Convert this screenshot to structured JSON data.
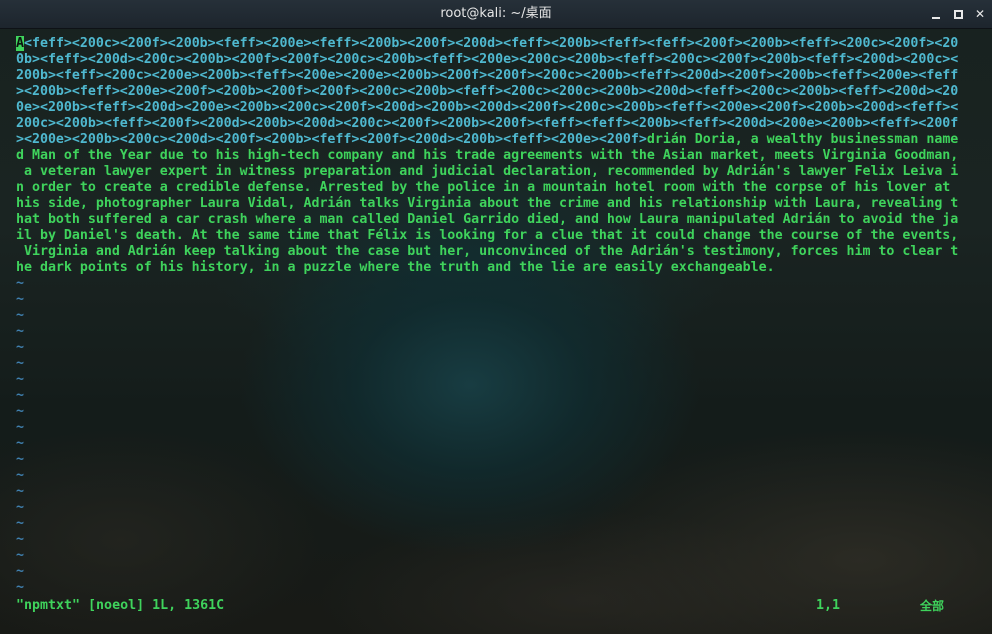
{
  "window": {
    "title": "root@kali: ~/桌面",
    "controls": [
      "minimize",
      "maximize",
      "close"
    ]
  },
  "editor": {
    "cursor_char": "A",
    "lines": [
      "<feff><200c><200f><200b><feff><200e><feff><200b><200f><200d><feff><200b><feff><feff><200f><200b><feff><200c><200f><20",
      "0b><feff><200d><200c><200b><200f><200f><200c><200b><feff><200e><200c><200b><feff><200c><200f><200b><feff><200d><200c><",
      "200b><feff><200c><200e><200b><feff><200e><200e><200b><200f><200f><200c><200b><feff><200d><200f><200b><feff><200e><feff",
      "><200b><feff><200e><200f><200b><200f><200f><200c><200b><feff><200c><200c><200b><200d><feff><200c><200b><feff><200d><20",
      "0e><200b><feff><200d><200e><200b><200c><200f><200d><200b><200d><200f><200c><200b><feff><200e><200f><200b><200d><feff><",
      "200c><200b><feff><200f><200d><200b><200d><200c><200f><200b><200f><feff><feff><200b><feff><200d><200e><200b><feff><200f",
      "><200e><200b><200c><200d><200f><200b><feff><200f><200d><200b><feff><200e><200f>drián Doria, a wealthy businessman name",
      "d Man of the Year due to his high-tech company and his trade agreements with the Asian market, meets Virginia Goodman,",
      " a veteran lawyer expert in witness preparation and judicial declaration, recommended by Adrián's lawyer Felix Leiva i",
      "n order to create a credible defense. Arrested by the police in a mountain hotel room with the corpse of his lover at",
      "his side, photographer Laura Vidal, Adrián talks Virginia about the crime and his relationship with Laura, revealing t",
      "hat both suffered a car crash where a man called Daniel Garrido died, and how Laura manipulated Adrián to avoid the ja",
      "il by Daniel's death. At the same time that Félix is looking for a clue that it could change the course of the events,",
      " Virginia and Adrián keep talking about the case but her, unconvinced of the Adrián's testimony, forces him to clear t",
      "he dark points of his history, in a puzzle where the truth and the lie are easily exchangeable."
    ],
    "line6_special": "><200e><200b><200c><200d><200f><200b><feff><200f><200d><200b><feff><200e><200f>",
    "line6_text": "drián Doria, a wealthy businessman name",
    "tilde": "~",
    "status": {
      "file_info": "\"npmtxt\" [noeol] 1L, 1361C",
      "position": "1,1",
      "scroll": "全部"
    }
  },
  "colors": {
    "text_green": "#3fd35c",
    "special_cyan": "#4fb8cf",
    "tilde_blue": "#3f7fae"
  }
}
